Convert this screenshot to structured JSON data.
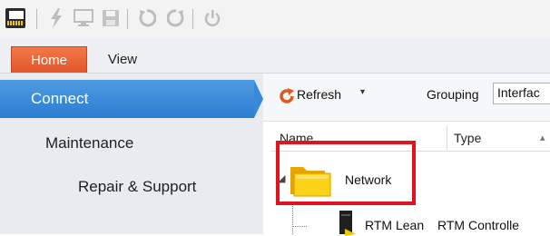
{
  "quick_access": {
    "icons": [
      "app-logo-icon",
      "lightning-icon",
      "monitor-icon",
      "save-icon",
      "undo-icon",
      "redo-icon",
      "power-icon"
    ]
  },
  "ribbon": {
    "tabs": [
      {
        "label": "Home",
        "active": true
      },
      {
        "label": "View",
        "active": false
      }
    ]
  },
  "nav": {
    "items": [
      {
        "label": "Connect",
        "selected": true
      },
      {
        "label": "Maintenance",
        "selected": false
      },
      {
        "label": "Repair & Support",
        "selected": false
      }
    ]
  },
  "toolbar": {
    "refresh_label": "Refresh",
    "refresh_caret": "▾",
    "grouping_label": "Grouping",
    "grouping_value": "Interfac"
  },
  "table": {
    "columns": [
      "Name",
      "Type"
    ],
    "rows": [
      {
        "name": "Network",
        "type": ""
      },
      {
        "name": "RTM Lean",
        "type": "RTM Controlle"
      }
    ]
  },
  "colors": {
    "accent_orange": "#e1552a",
    "nav_selected": "#2c7dd2",
    "highlight_red": "#e0141e"
  }
}
